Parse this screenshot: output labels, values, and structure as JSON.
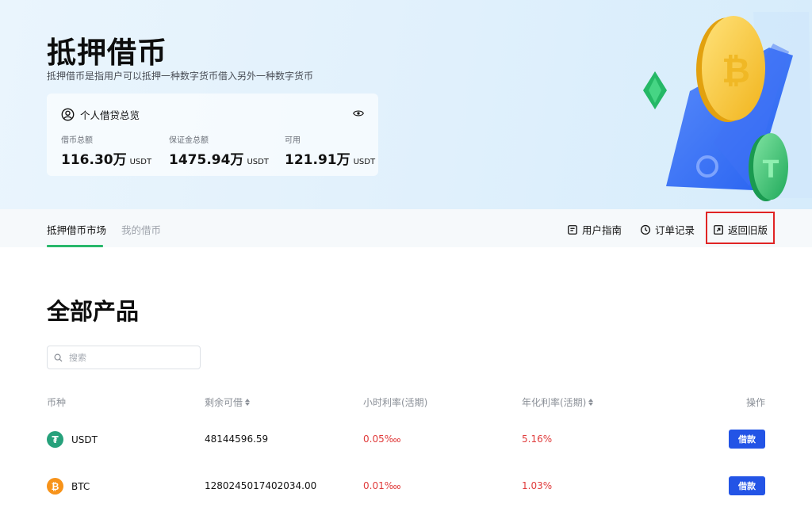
{
  "hero": {
    "title": "抵押借币",
    "subtitle": "抵押借币是指用户可以抵押一种数字货币借入另外一种数字货币"
  },
  "overview": {
    "title": "个人借贷总览",
    "user_icon": "user-circle-icon",
    "eye_icon": "eye-icon",
    "stats": [
      {
        "label": "借币总额",
        "value": "116.30万",
        "unit": "USDT"
      },
      {
        "label": "保证金总额",
        "value": "1475.94万",
        "unit": "USDT"
      },
      {
        "label": "可用",
        "value": "121.91万",
        "unit": "USDT"
      }
    ]
  },
  "tabs": [
    {
      "label": "抵押借币市场",
      "active": true
    },
    {
      "label": "我的借币",
      "active": false
    }
  ],
  "actions": {
    "guide": "用户指南",
    "orders": "订单记录",
    "old_version": "返回旧版"
  },
  "section": {
    "title": "全部产品"
  },
  "search": {
    "placeholder": "搜索",
    "value": ""
  },
  "table": {
    "headers": {
      "coin": "币种",
      "remaining": "剩余可借",
      "hourly": "小时利率(活期)",
      "annual": "年化利率(活期)",
      "action": "操作"
    },
    "rows": [
      {
        "coin": "USDT",
        "remaining": "48144596.59",
        "hourly": "0.05‱",
        "annual": "5.16%",
        "button": "借款"
      },
      {
        "coin": "BTC",
        "remaining": "1280245017402034.00",
        "hourly": "0.01‱",
        "annual": "1.03%",
        "button": "借款"
      }
    ]
  },
  "colors": {
    "accent_green": "#28b86b",
    "primary_blue": "#2354e6",
    "rate_red": "#e03b3b",
    "highlight_red": "#e02424",
    "usdt_green": "#26a17b",
    "btc_orange": "#f7931a"
  }
}
